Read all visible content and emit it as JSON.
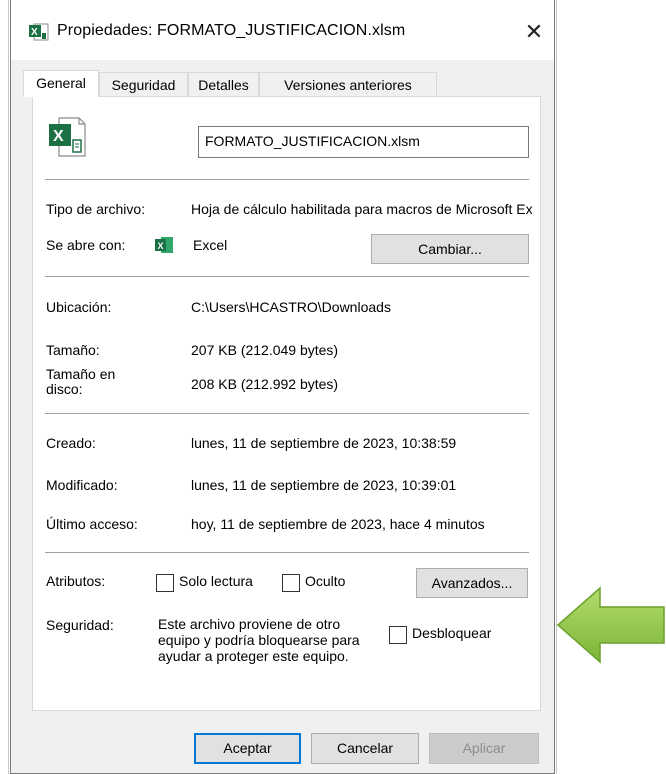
{
  "window": {
    "title": "Propiedades: FORMATO_JUSTIFICACION.xlsm",
    "close_glyph": "✕"
  },
  "tabs": [
    {
      "label": "General"
    },
    {
      "label": "Seguridad"
    },
    {
      "label": "Detalles"
    },
    {
      "label": "Versiones anteriores"
    }
  ],
  "file": {
    "name": "FORMATO_JUSTIFICACION.xlsm"
  },
  "labels": {
    "tipo": "Tipo de archivo:",
    "abre": "Se abre con:",
    "ubicacion": "Ubicación:",
    "tamano": "Tamaño:",
    "tamano_disco_1": "Tamaño en",
    "tamano_disco_2": "disco:",
    "creado": "Creado:",
    "modificado": "Modificado:",
    "ultimo": "Último acceso:",
    "atributos": "Atributos:",
    "seguridad": "Seguridad:"
  },
  "values": {
    "tipo": "Hoja de cálculo habilitada para macros de Microsoft Excel",
    "abre_app": "Excel",
    "ubicacion": "C:\\Users\\HCASTRO\\Downloads",
    "tamano": "207 KB (212.049 bytes)",
    "tamano_disco": "208 KB (212.992 bytes)",
    "creado": "lunes, 11 de septiembre de 2023, 10:38:59",
    "modificado": "lunes, 11 de septiembre de 2023, 10:39:01",
    "ultimo": "hoy, 11 de septiembre de 2023, hace 4 minutos"
  },
  "attributes": {
    "solo_lectura": "Solo lectura",
    "oculto": "Oculto",
    "avanzados": "Avanzados..."
  },
  "security": {
    "line1": "Este archivo proviene de otro",
    "line2": "equipo y podría bloquearse para",
    "line3": "ayudar a proteger este equipo.",
    "unblock": "Desbloquear"
  },
  "buttons": {
    "cambiar": "Cambiar...",
    "aceptar": "Aceptar",
    "cancelar": "Cancelar",
    "aplicar": "Aplicar"
  },
  "colors": {
    "arrow_fill": "#8cc63e",
    "excel_green": "#1d7044",
    "focus_blue": "#0078d7"
  }
}
